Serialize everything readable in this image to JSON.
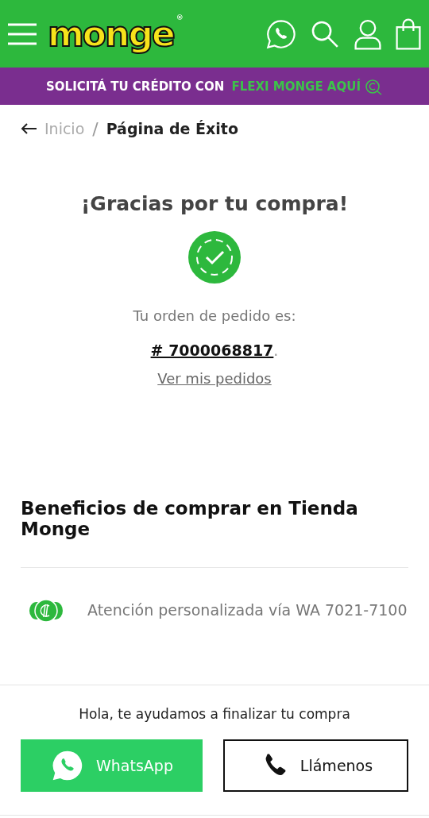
{
  "header": {
    "logo": "monge",
    "logo_mark": "®"
  },
  "promo": {
    "text": "SOLICITÁ TU CRÉDITO CON ",
    "highlight": "FLEXI MONGE AQUÍ"
  },
  "breadcrumb": [
    {
      "label": "Inicio",
      "current": false
    },
    {
      "label": "/",
      "kind": "separator"
    },
    {
      "label": "Página de Éxito",
      "current": true
    }
  ],
  "confirmation": {
    "title": "¡Gracias por tu compra!",
    "order_label": "Tu orden de pedido es:",
    "order_number": "# 7000068817",
    "order_end": ".",
    "link": "Ver mis pedidos"
  },
  "benefits": {
    "title": "Beneficios de comprar en Tienda Monge",
    "items": [
      {
        "text": "Atención personalizada vía WA 7021-7100"
      }
    ]
  },
  "help": {
    "text": "Hola, te ayudamos a finalizar tu compra",
    "buttons": [
      {
        "label": "WhatsApp",
        "kind": "whatsapp"
      },
      {
        "label": "Llámenos",
        "kind": "phone"
      }
    ]
  }
}
